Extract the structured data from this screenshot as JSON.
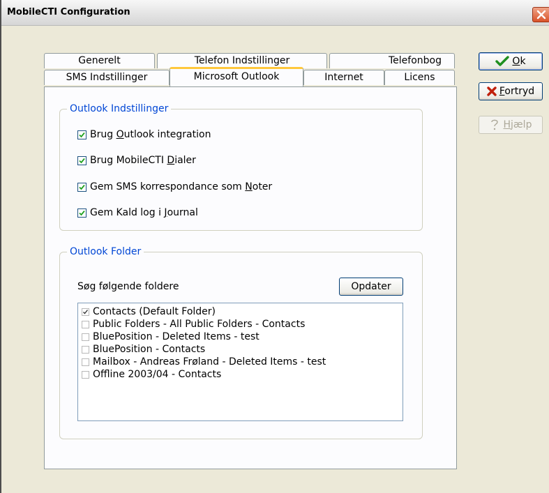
{
  "window": {
    "title": "MobileCTI Configuration"
  },
  "tabs_row1": [
    {
      "label": "Generelt"
    },
    {
      "label": "Telefon Indstillinger"
    },
    {
      "label": "Telefonbog"
    }
  ],
  "tabs_row2": [
    {
      "label": "SMS Indstillinger"
    },
    {
      "label": "Microsoft Outlook",
      "active": true
    },
    {
      "label": "Internet"
    },
    {
      "label": "Licens"
    }
  ],
  "outlook_settings": {
    "title": "Outlook Indstillinger",
    "options": [
      {
        "pre": "Brug ",
        "key": "O",
        "post": "utlook integration",
        "checked": true
      },
      {
        "pre": "Brug MobileCTI ",
        "key": "D",
        "post": "ialer",
        "checked": true
      },
      {
        "pre": "Gem SMS korrespondance som ",
        "key": "N",
        "post": "oter",
        "checked": true
      },
      {
        "pre": "Gem Kald log i ",
        "key": "J",
        "post": "ournal",
        "checked": true
      }
    ]
  },
  "outlook_folder": {
    "title": "Outlook Folder",
    "search_label": "Søg følgende foldere",
    "update_button": "Opdater",
    "folders": [
      {
        "label": "Contacts (Default Folder)",
        "checked": true
      },
      {
        "label": "Public Folders - All Public Folders - Contacts",
        "checked": false
      },
      {
        "label": "BluePosition - Deleted Items - test",
        "checked": false
      },
      {
        "label": "BluePosition - Contacts",
        "checked": false
      },
      {
        "label": "Mailbox - Andreas Frøland - Deleted Items - test",
        "checked": false
      },
      {
        "label": "Offline 2003/04 - Contacts",
        "checked": false
      }
    ]
  },
  "buttons": {
    "ok": {
      "key": "O",
      "post": "k"
    },
    "cancel": {
      "key": "F",
      "post": "ortryd"
    },
    "help": {
      "key": "H",
      "post": "jælp"
    }
  },
  "colors": {
    "accent": "#0046d5",
    "active_tab": "#ffc83c",
    "close": "#d9532a"
  }
}
